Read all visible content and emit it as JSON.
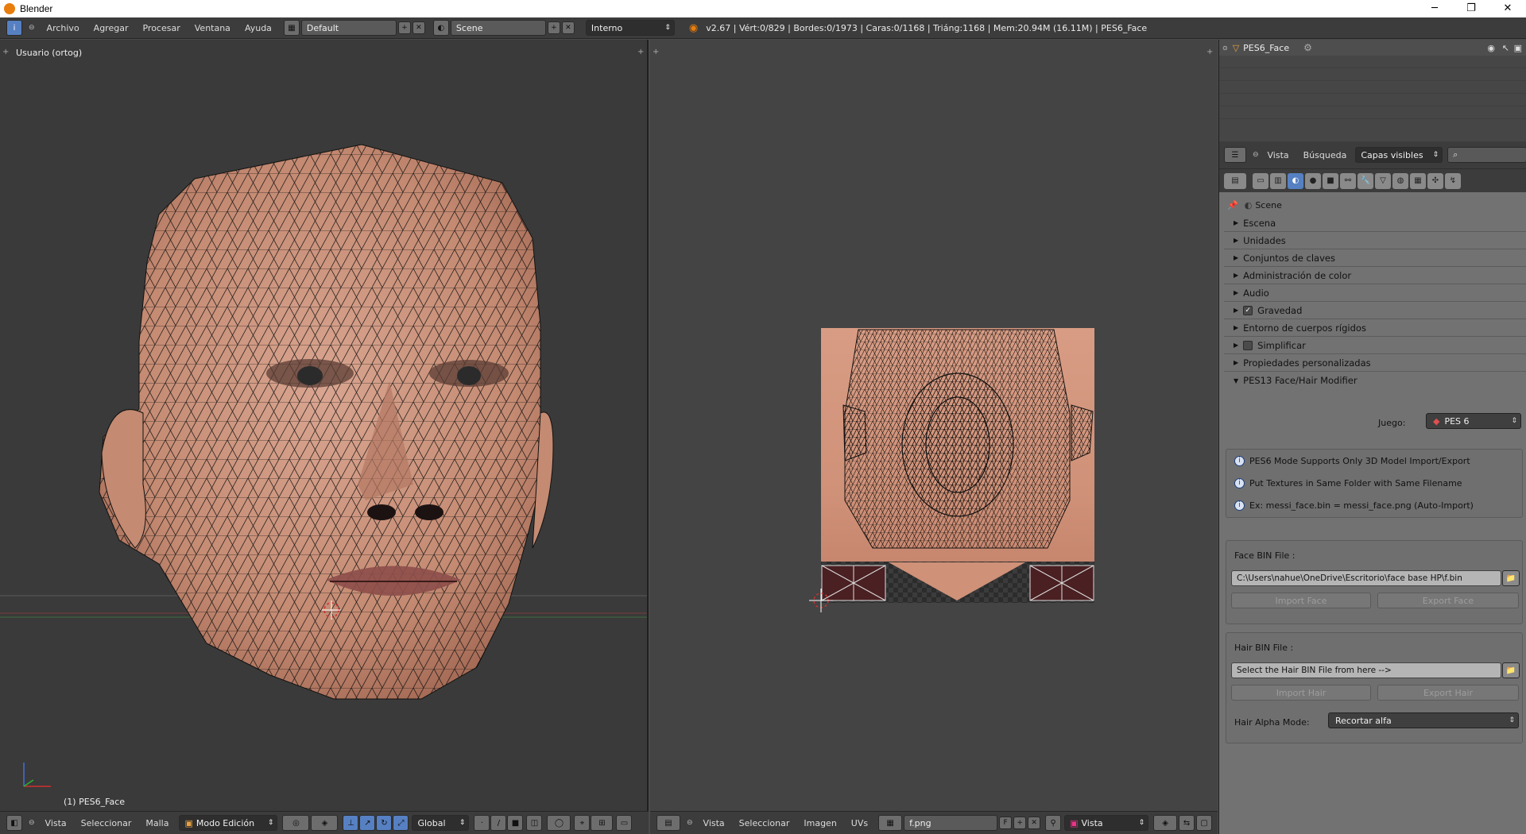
{
  "window": {
    "title": "Blender",
    "minimize": "─",
    "maximize": "❐",
    "close": "✕"
  },
  "menu": {
    "items": [
      "Archivo",
      "Agregar",
      "Procesar",
      "Ventana",
      "Ayuda"
    ]
  },
  "topbar": {
    "screen_layout": "Default",
    "scene": "Scene",
    "render_engine": "Interno",
    "stats": "v2.67 | Vért:0/829 | Bordes:0/1973 | Caras:0/1168 | Triáng:1168 | Mem:20.94M (16.11M) | PES6_Face"
  },
  "viewport3d": {
    "view_label": "Usuario (ortog)",
    "object_label": "(1) PES6_Face",
    "footer": {
      "menus": [
        "Vista",
        "Seleccionar",
        "Malla"
      ],
      "mode": "Modo Edición",
      "orientation": "Global"
    }
  },
  "uv_editor": {
    "footer": {
      "menus": [
        "Vista",
        "Seleccionar",
        "Imagen",
        "UVs"
      ],
      "image_name": "f.png",
      "image_fake_user": "F",
      "view_mode": "Vista"
    }
  },
  "outliner": {
    "object_name": "PES6_Face"
  },
  "properties_header": {
    "menus": [
      "Vista",
      "Búsqueda"
    ],
    "filter": "Capas visibles"
  },
  "properties": {
    "context_label": "Scene",
    "panels": [
      {
        "label": "Escena",
        "checkbox": false
      },
      {
        "label": "Unidades",
        "checkbox": false
      },
      {
        "label": "Conjuntos de claves",
        "checkbox": false
      },
      {
        "label": "Administración de color",
        "checkbox": false
      },
      {
        "label": "Audio",
        "checkbox": false
      },
      {
        "label": "Gravedad",
        "checkbox": true
      },
      {
        "label": "Entorno de cuerpos rígidos",
        "checkbox": false
      },
      {
        "label": "Simplificar",
        "checkbox": false
      },
      {
        "label": "Propiedades personalizadas",
        "checkbox": false
      },
      {
        "label": "PES13 Face/Hair Modifier",
        "checkbox": false
      }
    ],
    "addon": {
      "game_label": "Juego:",
      "game_value": "PES 6",
      "info": [
        "PES6 Mode Supports Only 3D Model Import/Export",
        "Put Textures in Same Folder with Same Filename",
        "Ex: messi_face.bin = messi_face.png (Auto-Import)"
      ],
      "face_bin_label": "Face BIN File :",
      "face_bin_path": "C:\\Users\\nahue\\OneDrive\\Escritorio\\face base HP\\f.bin",
      "import_face": "Import Face",
      "export_face": "Export Face",
      "hair_bin_label": "Hair BIN File :",
      "hair_bin_path": "Select the Hair BIN File from here  -->",
      "import_hair": "Import Hair",
      "export_hair": "Export Hair",
      "alpha_label": "Hair Alpha Mode:",
      "alpha_value": "Recortar alfa"
    }
  },
  "colors": {
    "skin": "#c9907a",
    "accent": "#5680c2",
    "orange": "#e87d0d"
  }
}
